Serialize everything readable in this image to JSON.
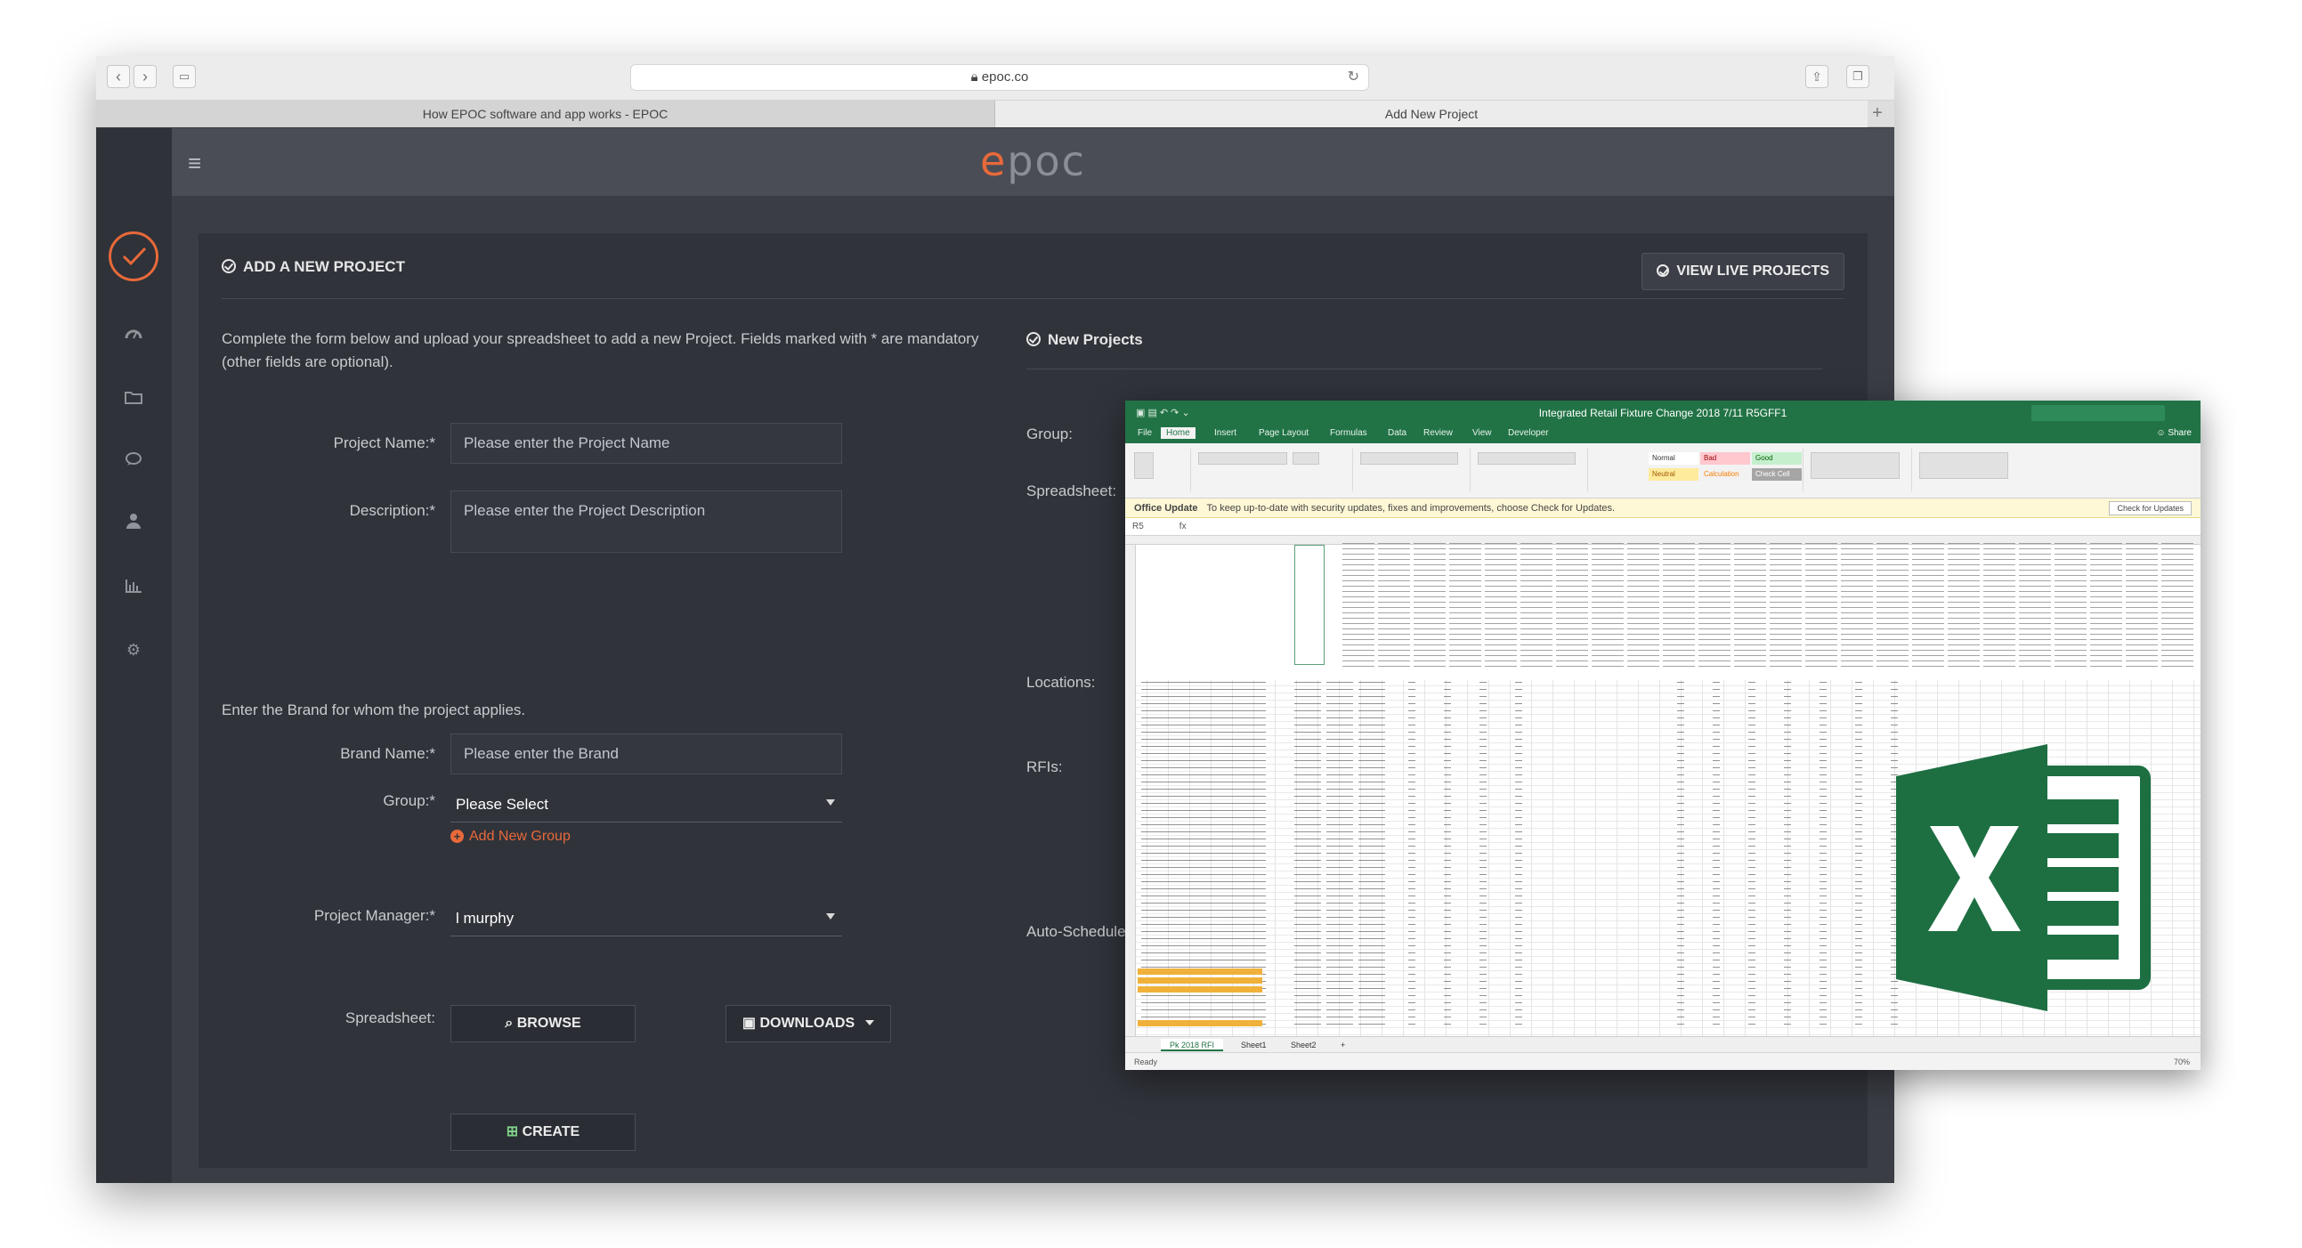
{
  "browser": {
    "url": "epoc.co",
    "tabs": [
      {
        "label": "How EPOC software and app works - EPOC"
      },
      {
        "label": "Add New Project"
      }
    ],
    "new_tab": "+"
  },
  "app": {
    "logo_text_accent": "e",
    "logo_text_rest": "poc",
    "menu_icon": "menu-icon",
    "sidebar_icons": [
      "dashboard-icon",
      "folder-icon",
      "chat-icon",
      "user-icon",
      "chart-icon",
      "settings-icon"
    ],
    "accent_color": "#e8693a"
  },
  "form": {
    "title": "ADD A NEW PROJECT",
    "view_live_label": "VIEW LIVE PROJECTS",
    "intro": "Complete the form below and upload your spreadsheet to add a new Project. Fields marked with * are mandatory (other fields are optional).",
    "project_name_label": "Project Name:*",
    "project_name_placeholder": "Please enter the Project Name",
    "description_label": "Description:*",
    "description_placeholder": "Please enter the Project Description",
    "brand_note": "Enter the Brand for whom the project applies.",
    "brand_name_label": "Brand Name:*",
    "brand_name_placeholder": "Please enter the Brand",
    "group_label": "Group:*",
    "group_value": "Please Select",
    "add_group_label": "Add New Group",
    "project_manager_label": "Project Manager:*",
    "project_manager_value": "l murphy",
    "spreadsheet_label": "Spreadsheet:",
    "browse_label": "BROWSE",
    "downloads_label": "DOWNLOADS",
    "create_label": "CREATE"
  },
  "new_projects": {
    "title": "New Projects",
    "labels": {
      "group": "Group:",
      "spreadsheet": "Spreadsheet:",
      "locations": "Locations:",
      "rfis": "RFIs:",
      "auto_schedule": "Auto-Schedule:"
    }
  },
  "excel": {
    "title": "Integrated Retail Fixture Change 2018 7/11 R5GFF1",
    "tabs": [
      "File",
      "Home",
      "Insert",
      "Page Layout",
      "Formulas",
      "Data",
      "Review",
      "View",
      "Developer"
    ],
    "share_label": "Share",
    "notice_title": "Office Update",
    "notice_text": "To keep up-to-date with security updates, fixes and improvements, choose Check for Updates.",
    "notice_button": "Check for Updates",
    "name_box": "R5",
    "sheet_tabs": [
      "Pk 2018 RFI",
      "Sheet1",
      "Sheet2"
    ],
    "status": "Ready",
    "zoom": "70%",
    "style_cells": [
      "Normal",
      "Bad",
      "Good",
      "Neutral",
      "Calculation",
      "Check Cell"
    ]
  }
}
